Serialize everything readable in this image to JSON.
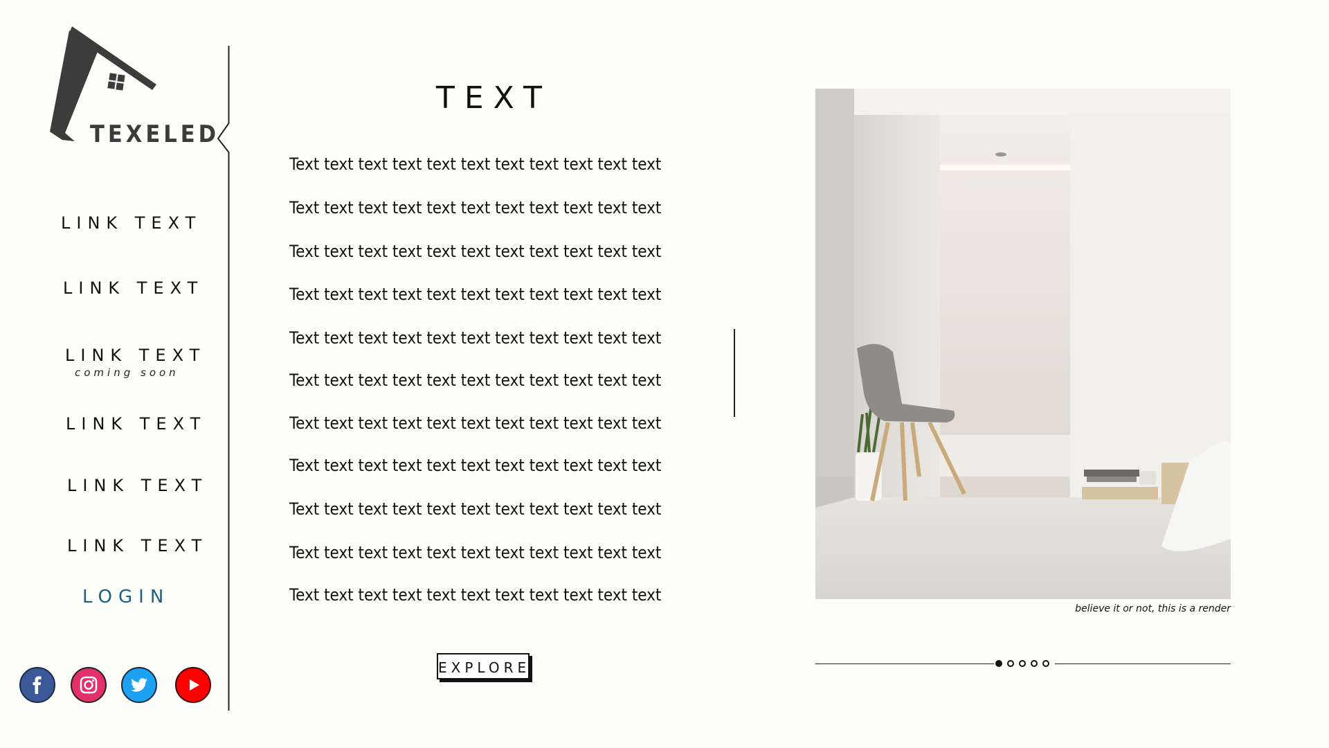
{
  "brand": {
    "name": "TEXELED"
  },
  "nav": {
    "links": [
      {
        "label": "LINK TEXT"
      },
      {
        "label": "LINK TEXT"
      },
      {
        "label": "LINK TEXT",
        "note": "coming soon"
      },
      {
        "label": "LINK TEXT"
      },
      {
        "label": "LINK TEXT"
      },
      {
        "label": "LINK TEXT"
      }
    ],
    "login": "LOGIN"
  },
  "social": [
    {
      "icon": "facebook-icon",
      "color": "#3b5998"
    },
    {
      "icon": "instagram-icon",
      "color": "#e1306c"
    },
    {
      "icon": "twitter-icon",
      "color": "#1da1f2"
    },
    {
      "icon": "youtube-icon",
      "color": "#ff0000"
    }
  ],
  "main": {
    "heading": "TEXT",
    "lines": [
      "Text text text text text text text text text text text",
      "Text text text text text text text text text text text",
      "Text text text text text text text text text text text",
      "Text text text text text text text text text text text",
      "Text text text text text text text text text text text",
      "Text text text text text text text text text text text",
      "Text text text text text text text text text text text",
      "Text text text text text text text text text text text",
      "Text text text text text text text text text text text",
      "Text text text text text text text text text text text",
      "Text text text text text text text text text text text"
    ],
    "explore": "EXPLORE"
  },
  "gallery": {
    "caption": "believe it or not, this is a render",
    "slide_count": 5,
    "active_slide": 1
  },
  "colors": {
    "background": "#fdfdf9",
    "login": "#1a5f86",
    "logo": "#3c3c3c"
  }
}
